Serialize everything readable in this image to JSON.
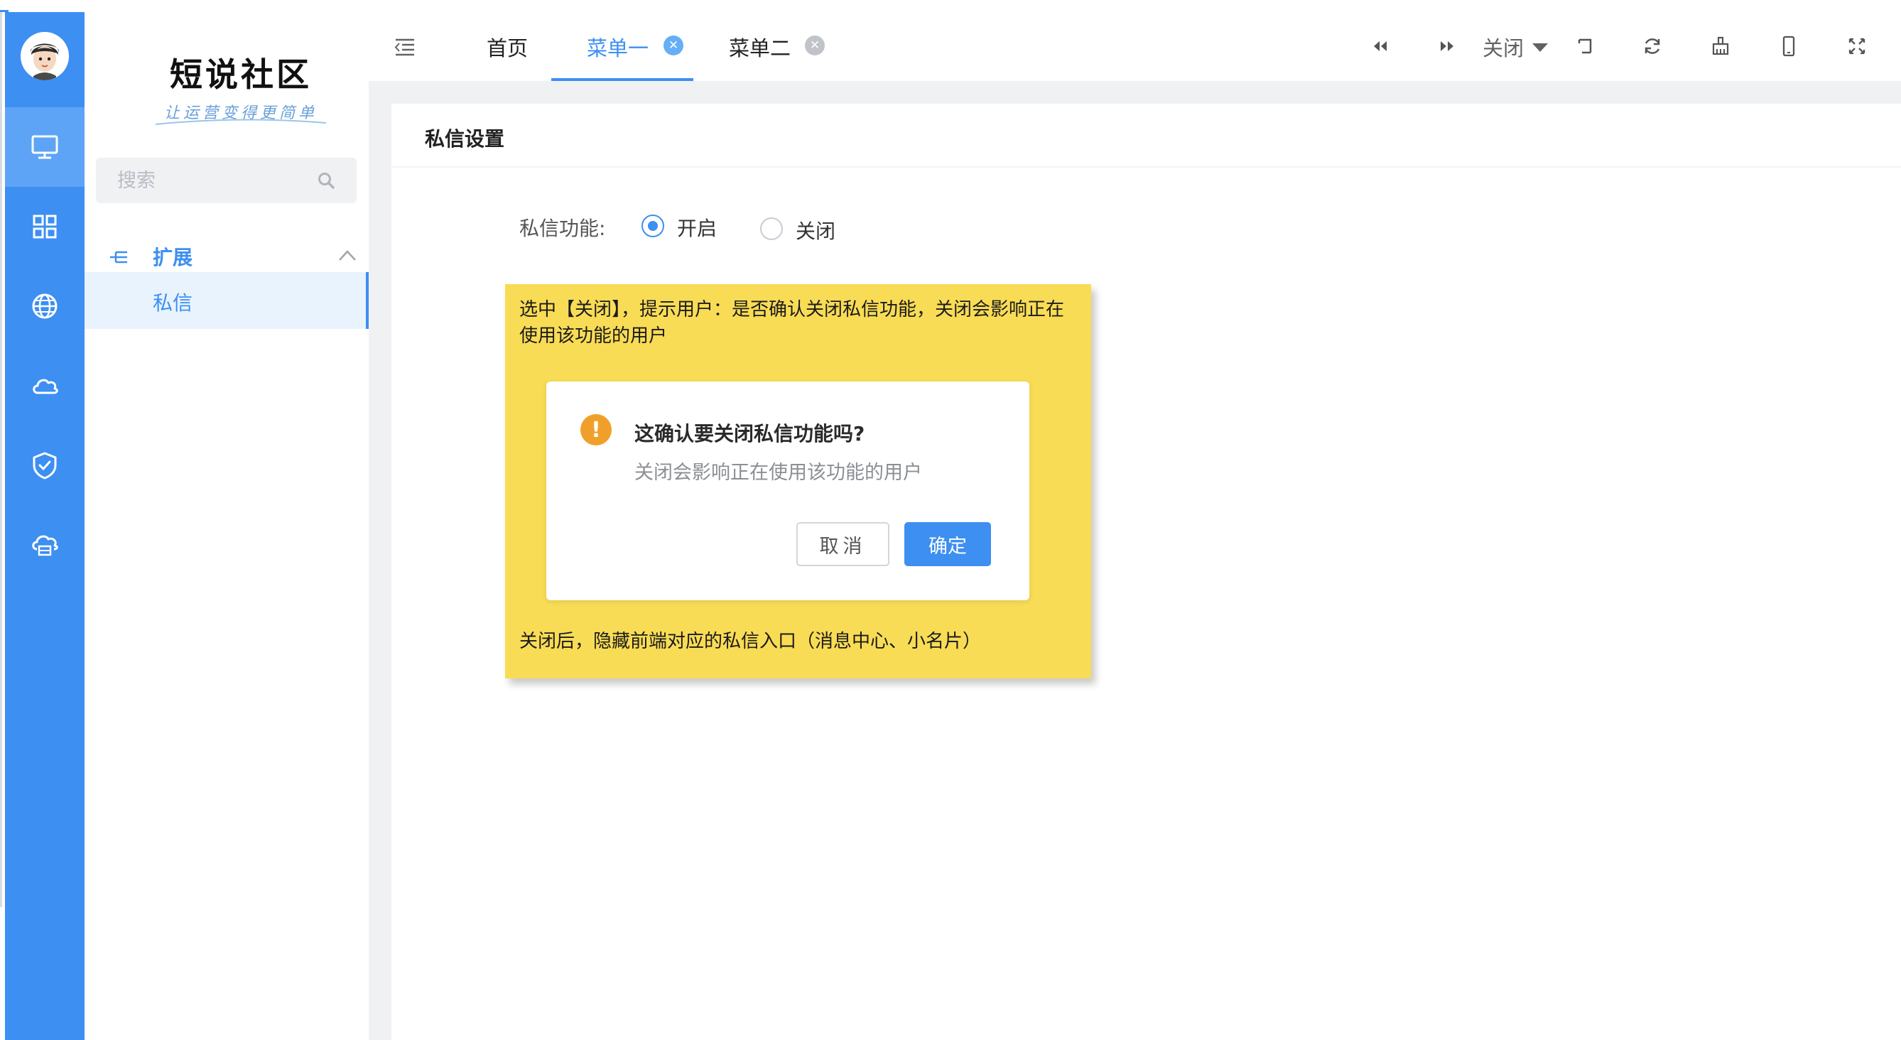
{
  "brand": {
    "title": "短说社区",
    "slogan": "让运营变得更简单"
  },
  "sidebar": {
    "search_placeholder": "搜索",
    "group_label": "扩展",
    "items": [
      {
        "label": "私信",
        "active": true
      }
    ]
  },
  "rail": {
    "icons": [
      "monitor-icon",
      "grid-icon",
      "globe-icon",
      "cloud-icon",
      "shield-check-icon",
      "cloud-storage-icon"
    ],
    "active_index": 0
  },
  "tabs": [
    {
      "label": "首页",
      "active": false,
      "closable": false
    },
    {
      "label": "菜单一",
      "active": true,
      "closable": true
    },
    {
      "label": "菜单二",
      "active": false,
      "closable": true
    }
  ],
  "toolbar": {
    "close_dropdown_label": "关闭"
  },
  "card": {
    "title": "私信设置"
  },
  "form": {
    "field_label": "私信功能:",
    "options": [
      {
        "label": "开启",
        "checked": true
      },
      {
        "label": "关闭",
        "checked": false
      }
    ]
  },
  "note": {
    "text": "选中【关闭】，提示用户：是否确认关闭私信功能，关闭会影响正在使用该功能的用户",
    "footer": "关闭后，隐藏前端对应的私信入口（消息中心、小名片）"
  },
  "dialog": {
    "title": "这确认要关闭私信功能吗?",
    "message": "关闭会影响正在使用该功能的用户",
    "cancel_label": "取消",
    "confirm_label": "确定"
  },
  "colors": {
    "accent": "#3d8ff2",
    "note_bg": "#f9dc55",
    "warning": "#f0a02a"
  }
}
